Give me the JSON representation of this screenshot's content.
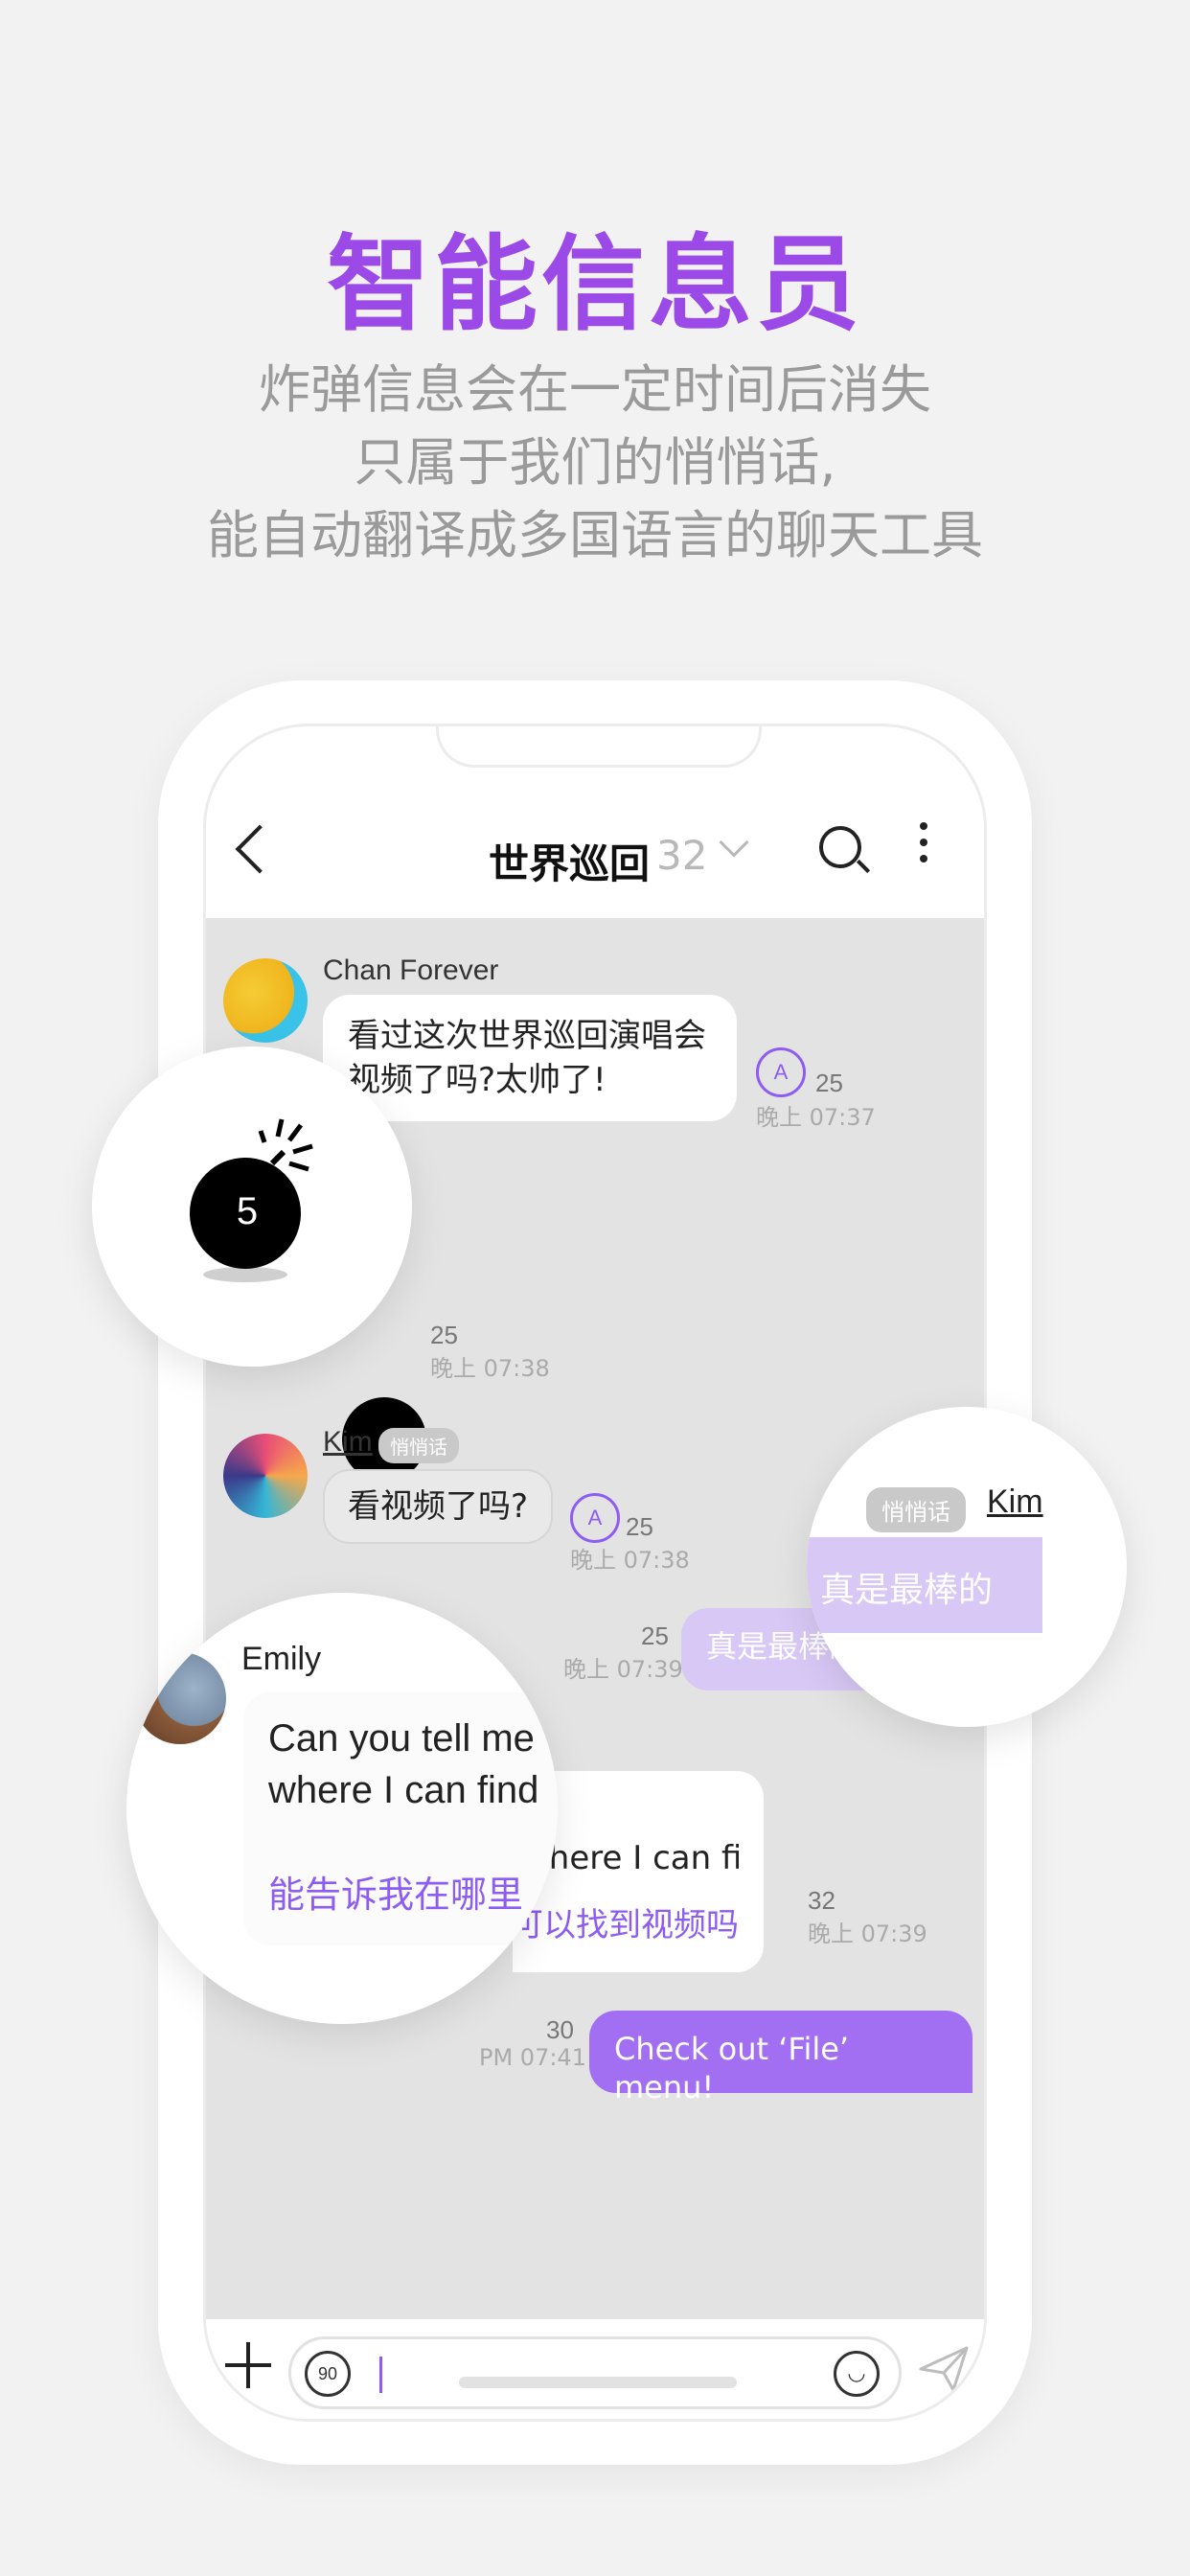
{
  "headline": "智能信息员",
  "sublines": [
    "炸弹信息会在一定时间后消失",
    "只属于我们的悄悄话,",
    "能自动翻译成多国语言的聊天工具"
  ],
  "chat": {
    "title": "世界巡回",
    "member_count": "32",
    "messages": {
      "m1": {
        "sender": "Chan Forever",
        "text_line1": "看过这次世界巡回演唱会",
        "text_line2": "视频了吗?太帅了!",
        "count": "25",
        "time": "晚上 07:37"
      },
      "m2": {
        "count": "25",
        "time": "晚上 07:38"
      },
      "m3": {
        "sender": "Kim",
        "tag": "悄悄话",
        "text": "看视频了吗?",
        "count": "25",
        "time": "晚上 07:38"
      },
      "m4": {
        "text": "真是最棒的",
        "count": "25",
        "time": "晚上 07:39"
      },
      "m5": {
        "sender": "Emily",
        "text_line1": "Can you tell me",
        "text_line2": "where I can find the video?",
        "translation": "能告诉我在哪里可以找到视频吗?",
        "count": "32",
        "time": "晚上 07:39"
      },
      "m6": {
        "text": "Check out ‘File’ menu!",
        "count": "30",
        "time": "PM 07:41"
      }
    }
  },
  "zoom_bomb": {
    "count": "5"
  },
  "zoom_kim": {
    "tag": "悄悄话",
    "name": "Kim",
    "text": "真是最棒的"
  },
  "zoom_emily": {
    "sender": "Emily",
    "line1": "Can you tell me",
    "line2": "where I can find",
    "translation": "能告诉我在哪里"
  },
  "input": {
    "timer": "90"
  },
  "colors": {
    "accent": "#9b4ae8",
    "bubble_mine": "#a36ff2",
    "bubble_mine_light": "#d8c8f6",
    "chat_bg": "#e3e3e3"
  }
}
